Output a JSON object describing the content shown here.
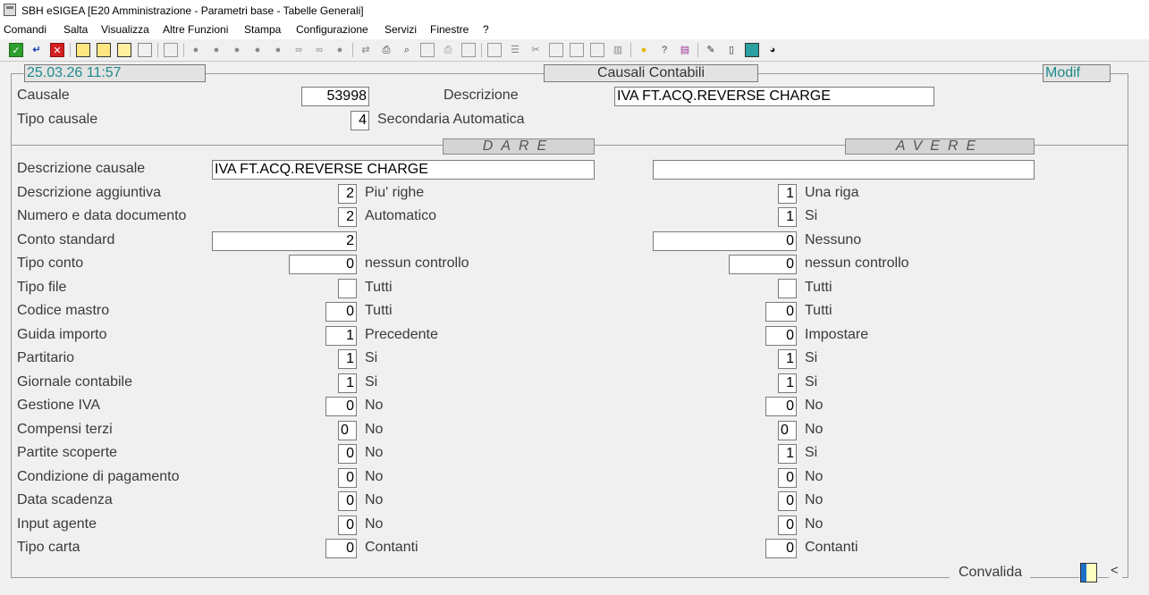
{
  "window": {
    "title": "SBH eSIGEA [E20 Amministrazione - Parametri base - Tabelle Generali]"
  },
  "menu": [
    "Comandi",
    "Salta",
    "Visualizza",
    "Altre Funzioni",
    "Stampa",
    "Configurazione",
    "Servizi",
    "Finestre",
    "?"
  ],
  "header": {
    "datetime": "25.03.26 11:57",
    "form_title": "Causali Contabili",
    "mode": "Modif"
  },
  "top": {
    "causale_label": "Causale",
    "causale_value": "53998",
    "descrizione_label": "Descrizione",
    "descrizione_value": "IVA FT.ACQ.REVERSE CHARGE",
    "tipo_causale_label": "Tipo causale",
    "tipo_causale_value": "4",
    "tipo_causale_desc": "Secondaria Automatica"
  },
  "sections": {
    "dare": "DARE",
    "avere": "AVERE"
  },
  "rows": [
    {
      "label": "Descrizione causale",
      "dare_value": "IVA FT.ACQ.REVERSE CHARGE",
      "dare_desc": "",
      "avere_value": "",
      "avere_desc": ""
    },
    {
      "label": "Descrizione aggiuntiva",
      "dare_value": "2",
      "dare_desc": "Piu' righe",
      "avere_value": "1",
      "avere_desc": "Una riga"
    },
    {
      "label": "Numero e data documento",
      "dare_value": "2",
      "dare_desc": "Automatico",
      "avere_value": "1",
      "avere_desc": "Si"
    },
    {
      "label": "Conto standard",
      "dare_value": "2",
      "dare_desc": "",
      "avere_value": "0",
      "avere_desc": "Nessuno"
    },
    {
      "label": "Tipo conto",
      "dare_value": "0",
      "dare_desc": "nessun controllo",
      "avere_value": "0",
      "avere_desc": "nessun controllo"
    },
    {
      "label": "Tipo file",
      "dare_value": "",
      "dare_desc": "Tutti",
      "avere_value": "",
      "avere_desc": "Tutti"
    },
    {
      "label": "Codice mastro",
      "dare_value": "0",
      "dare_desc": "Tutti",
      "avere_value": "0",
      "avere_desc": "Tutti"
    },
    {
      "label": "Guida importo",
      "dare_value": "1",
      "dare_desc": "Precedente",
      "avere_value": "0",
      "avere_desc": "Impostare"
    },
    {
      "label": "Partitario",
      "dare_value": "1",
      "dare_desc": "Si",
      "avere_value": "1",
      "avere_desc": "Si"
    },
    {
      "label": "Giornale contabile",
      "dare_value": "1",
      "dare_desc": "Si",
      "avere_value": "1",
      "avere_desc": "Si"
    },
    {
      "label": "Gestione IVA",
      "dare_value": "0",
      "dare_desc": "No",
      "avere_value": "0",
      "avere_desc": "No"
    },
    {
      "label": "Compensi terzi",
      "dare_value": "0",
      "dare_desc": "No",
      "avere_value": "0",
      "avere_desc": "No"
    },
    {
      "label": "Partite scoperte",
      "dare_value": "0",
      "dare_desc": "No",
      "avere_value": "1",
      "avere_desc": "Si"
    },
    {
      "label": "Condizione di pagamento",
      "dare_value": "0",
      "dare_desc": "No",
      "avere_value": "0",
      "avere_desc": "No"
    },
    {
      "label": "Data scadenza",
      "dare_value": "0",
      "dare_desc": "No",
      "avere_value": "0",
      "avere_desc": "No"
    },
    {
      "label": "Input agente",
      "dare_value": "0",
      "dare_desc": "No",
      "avere_value": "0",
      "avere_desc": "No"
    },
    {
      "label": "Tipo carta",
      "dare_value": "0",
      "dare_desc": "Contanti",
      "avere_value": "0",
      "avere_desc": "Contanti"
    }
  ],
  "footer": {
    "convalida_label": "Convalida",
    "arrow": "<"
  }
}
